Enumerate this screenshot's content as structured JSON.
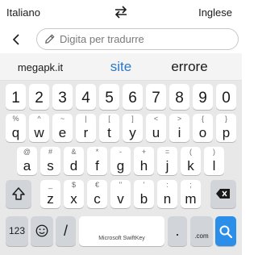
{
  "header": {
    "source_language": "Italiano",
    "target_language": "Inglese",
    "swap_icon": "swap-arrows-icon"
  },
  "input": {
    "placeholder": "Digita per tradurre",
    "back_icon": "back-chevron-icon",
    "pencil_icon": "pencil-icon"
  },
  "suggestions": [
    "megapk.it",
    "site",
    "errore"
  ],
  "keyboard": {
    "number_row": [
      "1",
      "2",
      "3",
      "4",
      "5",
      "6",
      "7",
      "8",
      "9",
      "0"
    ],
    "row1": [
      {
        "key": "q",
        "alt": "%"
      },
      {
        "key": "w",
        "alt": "^"
      },
      {
        "key": "e",
        "alt": "~"
      },
      {
        "key": "r",
        "alt": "|"
      },
      {
        "key": "t",
        "alt": "["
      },
      {
        "key": "y",
        "alt": "]"
      },
      {
        "key": "u",
        "alt": "<"
      },
      {
        "key": "i",
        "alt": ">"
      },
      {
        "key": "o",
        "alt": "{"
      },
      {
        "key": "p",
        "alt": "}"
      }
    ],
    "row2": [
      {
        "key": "a",
        "alt": "@"
      },
      {
        "key": "s",
        "alt": "#"
      },
      {
        "key": "d",
        "alt": "&"
      },
      {
        "key": "f",
        "alt": "*"
      },
      {
        "key": "g",
        "alt": "-"
      },
      {
        "key": "h",
        "alt": "+"
      },
      {
        "key": "j",
        "alt": "="
      },
      {
        "key": "k",
        "alt": "("
      },
      {
        "key": "l",
        "alt": ")"
      }
    ],
    "row3": [
      {
        "key": "z",
        "alt": "_"
      },
      {
        "key": "x",
        "alt": "$"
      },
      {
        "key": "c",
        "alt": "€"
      },
      {
        "key": "v",
        "alt": "\""
      },
      {
        "key": "b",
        "alt": "'"
      },
      {
        "key": "n",
        "alt": ":"
      },
      {
        "key": "m",
        "alt": ";"
      }
    ],
    "bottom": {
      "numbers_key": "123",
      "slash_key": "/",
      "space_label": "Microsoft SwiftKey",
      "period_key": ".",
      "com_key": ".com",
      "shift_icon": "shift-icon",
      "backspace_icon": "backspace-icon",
      "emoji_icon": "emoji-icon",
      "search_icon": "search-icon"
    },
    "accent_color": "#2b8ee8"
  }
}
